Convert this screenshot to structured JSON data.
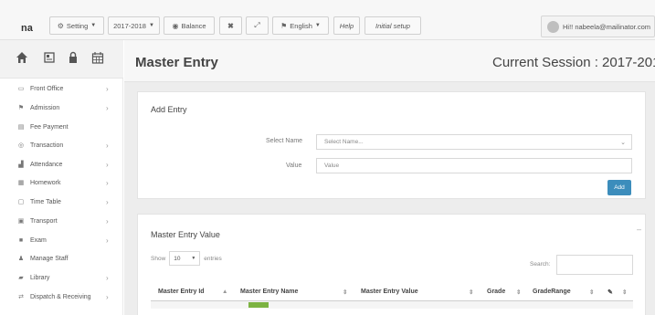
{
  "app": {
    "brand": "na"
  },
  "toolbar": {
    "setting_label": "Setting",
    "session_label": "2017-2018",
    "balance_label": "Balance",
    "language_label": "English",
    "help_label": "Help",
    "initial_setup_label": "Initial setup",
    "user_label": "Hi!! nabeela@mailinator.com"
  },
  "sidebar": {
    "items": [
      {
        "label": "Front Office",
        "icon": "monitor-icon",
        "has_arrow": true
      },
      {
        "label": "Admission",
        "icon": "flag-icon",
        "has_arrow": true
      },
      {
        "label": "Fee Payment",
        "icon": "money-icon",
        "has_arrow": false
      },
      {
        "label": "Transaction",
        "icon": "coin-icon",
        "has_arrow": true
      },
      {
        "label": "Attendance",
        "icon": "bar-chart-icon",
        "has_arrow": true
      },
      {
        "label": "Homework",
        "icon": "book-icon",
        "has_arrow": true
      },
      {
        "label": "Time Table",
        "icon": "calendar-icon",
        "has_arrow": true
      },
      {
        "label": "Transport",
        "icon": "bus-icon",
        "has_arrow": true
      },
      {
        "label": "Exam",
        "icon": "file-icon",
        "has_arrow": true
      },
      {
        "label": "Manage Staff",
        "icon": "users-icon",
        "has_arrow": false
      },
      {
        "label": "Library",
        "icon": "library-icon",
        "has_arrow": true
      },
      {
        "label": "Dispatch & Receiving",
        "icon": "exchange-icon",
        "has_arrow": true
      }
    ]
  },
  "page": {
    "title": "Master Entry",
    "session": "Current Session : 2017-2018"
  },
  "add_entry": {
    "title": "Add Entry",
    "select_name_label": "Select Name",
    "select_name_value": "Select Name...",
    "value_label": "Value",
    "value_placeholder": "Value",
    "add_button": "Add"
  },
  "master_values": {
    "title": "Master Entry Value",
    "show_label": "Show",
    "entries_value": "10",
    "entries_label": "entries",
    "search_label": "Search:",
    "columns": [
      "Master Entry Id",
      "Master Entry Name",
      "Master Entry Value",
      "Grade",
      "GradeRange"
    ]
  },
  "colors": {
    "accent": "#3c8dbc",
    "badge": "#7cb342"
  }
}
